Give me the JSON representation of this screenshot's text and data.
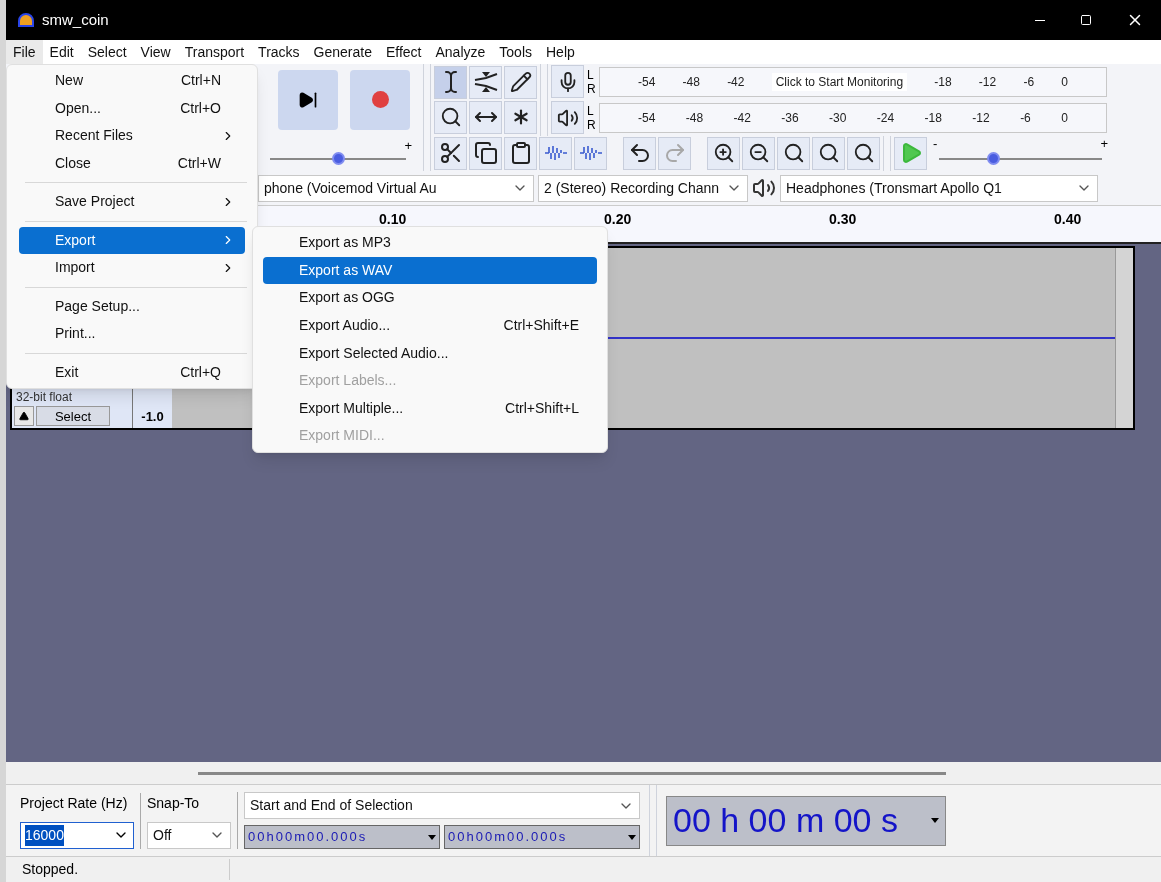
{
  "window": {
    "title": "smw_coin"
  },
  "menu_bar": [
    {
      "label": "File",
      "selected": true
    },
    {
      "label": "Edit",
      "selected": false
    },
    {
      "label": "Select",
      "selected": false
    },
    {
      "label": "View",
      "selected": false
    },
    {
      "label": "Transport",
      "selected": false
    },
    {
      "label": "Tracks",
      "selected": false
    },
    {
      "label": "Generate",
      "selected": false
    },
    {
      "label": "Effect",
      "selected": false
    },
    {
      "label": "Analyze",
      "selected": false
    },
    {
      "label": "Tools",
      "selected": false
    },
    {
      "label": "Help",
      "selected": false
    }
  ],
  "file_menu": [
    {
      "kind": "item",
      "label": "New",
      "shortcut": "Ctrl+N",
      "submenu": false,
      "selected": false
    },
    {
      "kind": "item",
      "label": "Open...",
      "shortcut": "Ctrl+O",
      "submenu": false,
      "selected": false
    },
    {
      "kind": "item",
      "label": "Recent Files",
      "submenu": true,
      "selected": false
    },
    {
      "kind": "item",
      "label": "Close",
      "shortcut": "Ctrl+W",
      "submenu": false,
      "selected": false
    },
    {
      "kind": "separator"
    },
    {
      "kind": "item",
      "label": "Save Project",
      "submenu": true,
      "selected": false
    },
    {
      "kind": "separator"
    },
    {
      "kind": "item",
      "label": "Export",
      "submenu": true,
      "selected": true
    },
    {
      "kind": "item",
      "label": "Import",
      "submenu": true,
      "selected": false
    },
    {
      "kind": "separator"
    },
    {
      "kind": "item",
      "label": "Page Setup...",
      "submenu": false,
      "selected": false
    },
    {
      "kind": "item",
      "label": "Print...",
      "submenu": false,
      "selected": false
    },
    {
      "kind": "separator"
    },
    {
      "kind": "item",
      "label": "Exit",
      "shortcut": "Ctrl+Q",
      "submenu": false,
      "selected": false
    }
  ],
  "export_submenu": [
    {
      "label": "Export as MP3",
      "disabled": false,
      "selected": false
    },
    {
      "label": "Export as WAV",
      "disabled": false,
      "selected": true
    },
    {
      "label": "Export as OGG",
      "disabled": false,
      "selected": false
    },
    {
      "label": "Export Audio...",
      "shortcut": "Ctrl+Shift+E",
      "disabled": false,
      "selected": false
    },
    {
      "label": "Export Selected Audio...",
      "disabled": false,
      "selected": false
    },
    {
      "label": "Export Labels...",
      "disabled": true,
      "selected": false
    },
    {
      "label": "Export Multiple...",
      "shortcut": "Ctrl+Shift+L",
      "disabled": false,
      "selected": false
    },
    {
      "label": "Export MIDI...",
      "disabled": true,
      "selected": false
    }
  ],
  "tools": [
    {
      "kind": "selection",
      "selected": true
    },
    {
      "kind": "envelope",
      "selected": false
    },
    {
      "kind": "draw",
      "selected": false
    },
    {
      "kind": "zoom",
      "selected": false
    },
    {
      "kind": "timeshift",
      "selected": false
    },
    {
      "kind": "multi",
      "selected": false
    }
  ],
  "recording_meter": {
    "channels": [
      "L",
      "R"
    ],
    "scale": [
      {
        "kind": "tick",
        "text": "-54"
      },
      {
        "kind": "tick",
        "text": "-48"
      },
      {
        "kind": "tick",
        "text": "-42"
      },
      {
        "kind": "prompt",
        "text": "Click to Start Monitoring"
      },
      {
        "kind": "tick",
        "text": "-18"
      },
      {
        "kind": "tick",
        "text": "-12"
      },
      {
        "kind": "tick",
        "text": "-6"
      },
      {
        "kind": "tick",
        "text": "0"
      }
    ]
  },
  "playback_meter": {
    "channels": [
      "L",
      "R"
    ],
    "scale": [
      {
        "kind": "tick",
        "text": "-54"
      },
      {
        "kind": "tick",
        "text": "-48"
      },
      {
        "kind": "tick",
        "text": "-42"
      },
      {
        "kind": "tick",
        "text": "-36"
      },
      {
        "kind": "tick",
        "text": "-30"
      },
      {
        "kind": "tick",
        "text": "-24"
      },
      {
        "kind": "tick",
        "text": "-18"
      },
      {
        "kind": "tick",
        "text": "-12"
      },
      {
        "kind": "tick",
        "text": "-6"
      },
      {
        "kind": "tick",
        "text": "0"
      }
    ]
  },
  "recording_volume": {
    "plus": "+",
    "level": 0.5
  },
  "history": [
    {
      "kind": "undo",
      "disabled": false
    },
    {
      "kind": "redo",
      "disabled": true
    }
  ],
  "playback_volume": {
    "minus": "-",
    "plus": "+",
    "level": 0.33
  },
  "devices": {
    "input": "phone (Voicemod Virtual Au",
    "channels": "2 (Stereo) Recording Chann",
    "output": "Headphones (Tronsmart Apollo Q1"
  },
  "ruler": [
    "0.10",
    "0.20",
    "0.30",
    "0.40"
  ],
  "track": {
    "format": "32-bit float",
    "select_button": "Select",
    "scale_label": "-1.0"
  },
  "selection_toolbar": {
    "project_rate_label": "Project Rate (Hz)",
    "project_rate": "16000",
    "snap_to_label": "Snap-To",
    "snap_to": "Off",
    "selection_mode": "Start and End of Selection",
    "start": "00h00m00.000s",
    "end": "00h00m00.000s",
    "time": "00 h 00 m 00 s"
  },
  "status_bar": {
    "text": "Stopped."
  }
}
